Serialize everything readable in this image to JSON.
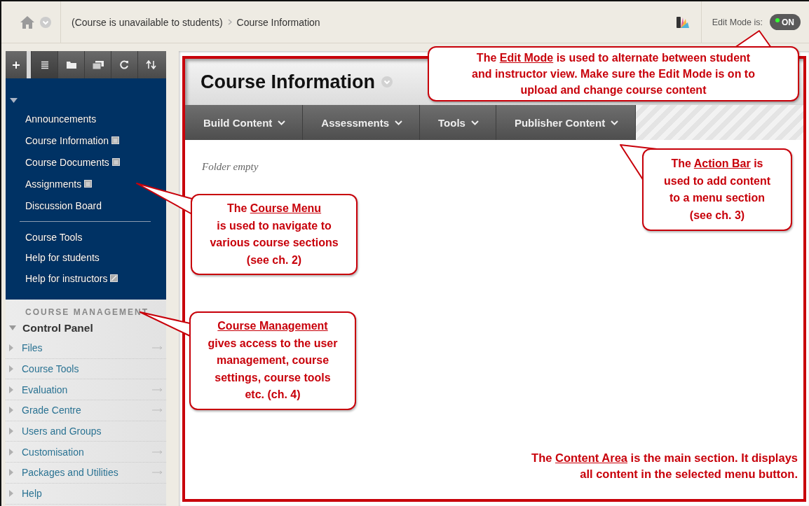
{
  "breadcrumb": {
    "items": [
      "(Course is unavailable to students)",
      "Course Information"
    ]
  },
  "edit_mode": {
    "label": "Edit Mode is:",
    "on": true,
    "toggle_text": "ON"
  },
  "sidebar": {
    "toolbar": [
      {
        "kind": "add",
        "selected": false
      },
      {
        "kind": "list",
        "selected": true
      },
      {
        "kind": "folder",
        "selected": false
      },
      {
        "kind": "stack",
        "selected": false
      },
      {
        "kind": "refresh",
        "selected": false
      },
      {
        "kind": "sort",
        "selected": false
      }
    ],
    "course_menu": {
      "expanded": true,
      "sections": [
        {
          "items": [
            {
              "label": "Announcements",
              "kind": "plain"
            },
            {
              "label": "Course Information",
              "kind": "page"
            },
            {
              "label": "Course Documents",
              "kind": "page"
            },
            {
              "label": "Assignments",
              "kind": "page"
            },
            {
              "label": "Discussion Board",
              "kind": "plain"
            }
          ]
        },
        {
          "items": [
            {
              "label": "Course Tools",
              "kind": "plain"
            },
            {
              "label": "Help for students",
              "kind": "plain"
            },
            {
              "label": "Help for instructors",
              "kind": "link"
            }
          ]
        }
      ]
    },
    "course_management": {
      "heading": "COURSE MANAGEMENT",
      "control_panel": {
        "label": "Control Panel",
        "expanded": true,
        "items": [
          {
            "label": "Files",
            "arrow": true
          },
          {
            "label": "Course Tools",
            "arrow": false
          },
          {
            "label": "Evaluation",
            "arrow": true
          },
          {
            "label": "Grade Centre",
            "arrow": true
          },
          {
            "label": "Users and Groups",
            "arrow": false
          },
          {
            "label": "Customisation",
            "arrow": true
          },
          {
            "label": "Packages and Utilities",
            "arrow": true
          },
          {
            "label": "Help",
            "arrow": false
          }
        ]
      }
    }
  },
  "content": {
    "title": "Course Information",
    "action_bar": [
      "Build Content",
      "Assessments",
      "Tools",
      "Publisher Content"
    ],
    "empty_text": "Folder empty",
    "note": {
      "parts": [
        {
          "text": "The ",
          "underline": false
        },
        {
          "text": "Content Area",
          "underline": true
        },
        {
          "text": " is the main section. It displays\nall content in the selected menu button.",
          "underline": false
        }
      ]
    }
  },
  "callouts": [
    {
      "parts": [
        {
          "text": "The ",
          "underline": false
        },
        {
          "text": "Edit Mode",
          "underline": true
        },
        {
          "text": " is used to alternate between student\nand instructor view. Make sure the Edit Mode is on to\nupload and change course content",
          "underline": false
        }
      ]
    },
    {
      "parts": [
        {
          "text": "The ",
          "underline": false
        },
        {
          "text": "Action Bar",
          "underline": true
        },
        {
          "text": " is\nused to add content\nto a menu section\n(see ch. 3)",
          "underline": false
        }
      ]
    },
    {
      "parts": [
        {
          "text": "The ",
          "underline": false
        },
        {
          "text": "Course Menu",
          "underline": true
        },
        {
          "text": "\nis used to navigate to\nvarious course sections\n(see ch. 2)",
          "underline": false
        }
      ]
    },
    {
      "parts": [
        {
          "text": "Course Management",
          "underline": true
        },
        {
          "text": "\ngives access to the user\nmanagement, course\nsettings, course tools\netc. (ch. 4)",
          "underline": false
        }
      ]
    }
  ]
}
